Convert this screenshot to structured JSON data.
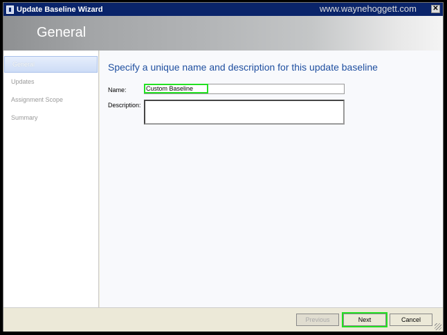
{
  "window": {
    "title": "Update Baseline Wizard",
    "watermark": "www.waynehoggett.com",
    "close_label": "✕"
  },
  "header": {
    "title": "General"
  },
  "sidebar": {
    "items": [
      {
        "label": "General"
      },
      {
        "label": "Updates"
      },
      {
        "label": "Assignment Scope"
      },
      {
        "label": "Summary"
      }
    ]
  },
  "main": {
    "heading": "Specify a unique name and description for this update baseline",
    "name_label": "Name:",
    "name_value": "Custom Baseline",
    "description_label": "Description:",
    "description_value": ""
  },
  "buttons": {
    "previous": "Previous",
    "next": "Next",
    "cancel": "Cancel"
  }
}
